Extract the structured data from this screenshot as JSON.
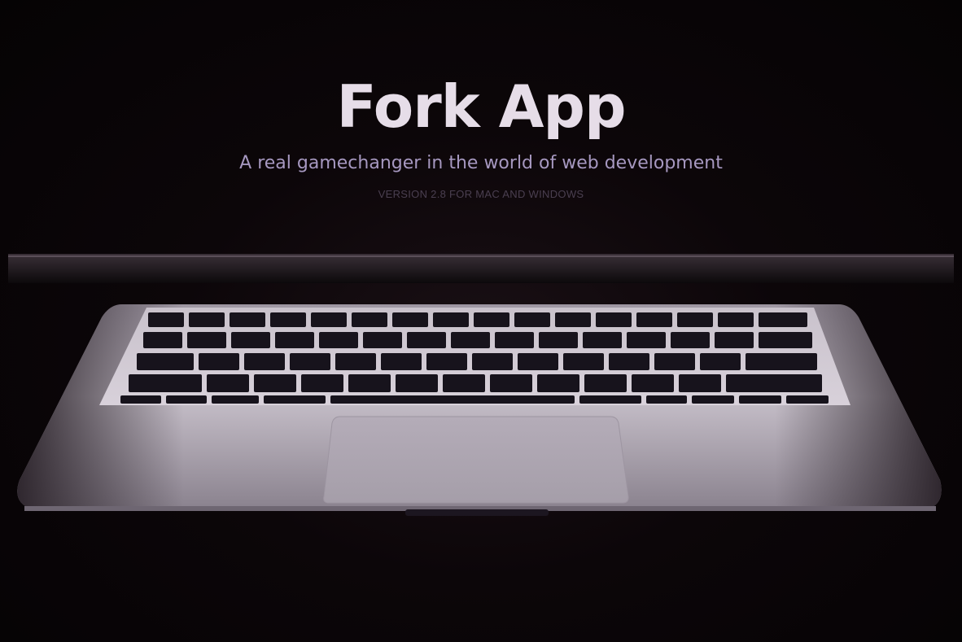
{
  "hero": {
    "title": "Fork App",
    "subtitle": "A real gamechanger in the world of web development",
    "version": "VERSION 2.8 FOR MAC AND WINDOWS"
  },
  "colors": {
    "background": "#0a0508",
    "title": "#e6dde8",
    "subtitle": "#a698c0",
    "version": "#4a3f50",
    "laptop_body": "#b8b0bc",
    "keys": "#17131c"
  }
}
